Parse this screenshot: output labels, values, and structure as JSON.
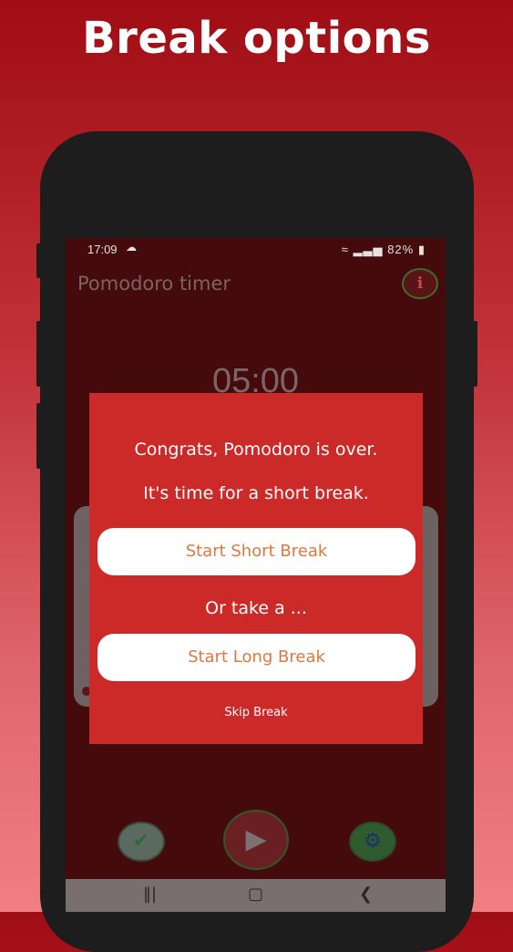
{
  "promo": {
    "title": "Break options"
  },
  "status_bar": {
    "time": "17:09",
    "battery": "82%"
  },
  "app": {
    "title": "Pomodoro timer",
    "timer": "05:00"
  },
  "dialog": {
    "message_congrats": "Congrats, Pomodoro is over.",
    "message_break": "It's time for a short break.",
    "short_break_label": "Start Short Break",
    "or_text": "Or take a ...",
    "long_break_label": "Start Long Break",
    "skip_label": "Skip Break"
  },
  "icons": {
    "info": "info-icon",
    "check": "check-icon",
    "play": "play-icon",
    "settings": "settings-icon"
  },
  "colors": {
    "dialog_bg": "#cc2929",
    "button_text": "#dd7840",
    "screen_bg": "#440a0c"
  }
}
